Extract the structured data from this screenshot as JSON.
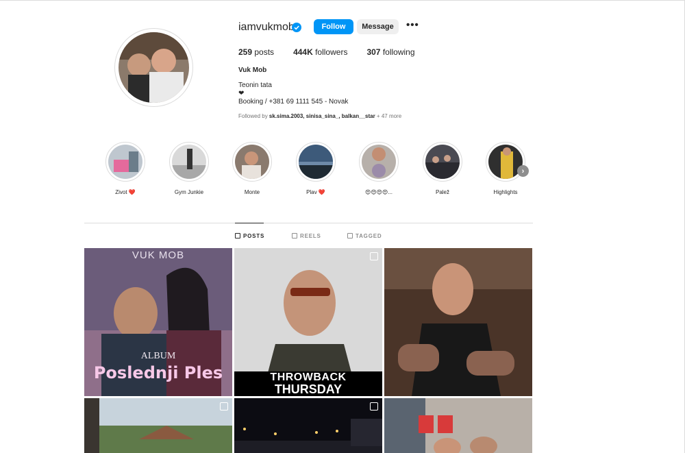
{
  "profile": {
    "username": "iamvukmob",
    "follow_label": "Follow",
    "message_label": "Message",
    "more_label": "•••",
    "stats": {
      "posts_count": "259",
      "posts_label": "posts",
      "followers_count": "444K",
      "followers_label": "followers",
      "following_count": "307",
      "following_label": "following"
    },
    "full_name": "Vuk Mob",
    "bio_line1": "Teonin tata",
    "bio_heart": "❤",
    "bio_line2": "Booking / +381 69 1111 545 - Novak",
    "followed_by_prefix": "Followed by ",
    "followed_by_users": "sk.sima.2003, sinisa_sina_, balkan__star",
    "followed_by_suffix": " + 47 more"
  },
  "highlights": [
    {
      "label": "Zivot ❤️",
      "icon": "highlight-cover"
    },
    {
      "label": "Gym Junkie",
      "icon": "highlight-cover"
    },
    {
      "label": "Monte",
      "icon": "highlight-cover"
    },
    {
      "label": "Plav ❤️",
      "icon": "highlight-cover"
    },
    {
      "label": "😍😍😍😍...",
      "icon": "highlight-cover"
    },
    {
      "label": "Palež",
      "icon": "highlight-cover"
    },
    {
      "label": "Highlights",
      "icon": "highlight-cover"
    }
  ],
  "tabs": [
    {
      "label": "POSTS",
      "icon": "grid-icon",
      "active": true
    },
    {
      "label": "REELS",
      "icon": "reels-icon",
      "active": false
    },
    {
      "label": "TAGGED",
      "icon": "tagged-icon",
      "active": false
    }
  ],
  "posts": [
    {
      "caption_top": "VUK MOB",
      "caption_mid": "ALBUM",
      "caption_bottom": "Poslednji Ples"
    },
    {
      "caption_top": "THROWBACK",
      "caption_bottom": "THURSDAY"
    },
    {},
    {},
    {},
    {}
  ],
  "colors": {
    "accent": "#0095f6",
    "verified": "#0095f6",
    "text": "#262626",
    "muted": "#737373"
  }
}
